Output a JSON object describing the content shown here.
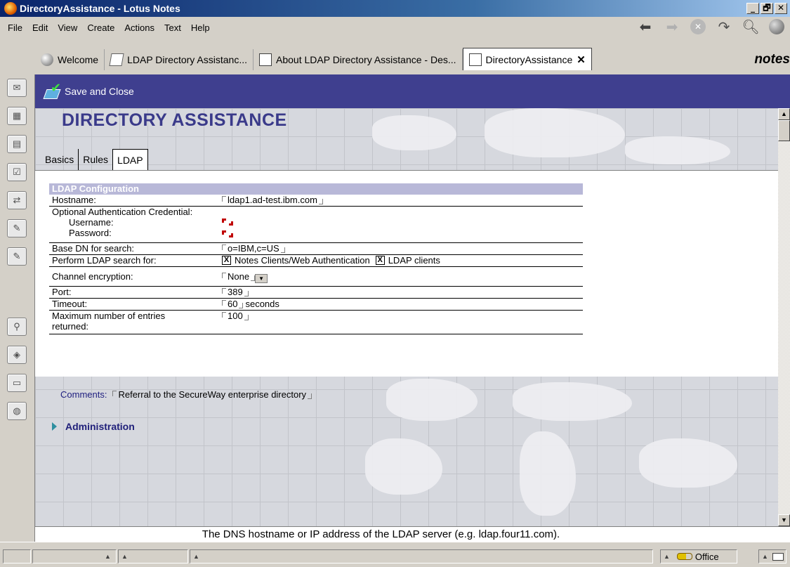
{
  "window": {
    "title": "DirectoryAssistance - Lotus Notes",
    "buttons": {
      "minimize": "_",
      "maximize": "🗗",
      "close": "✕"
    }
  },
  "menu": [
    "File",
    "Edit",
    "View",
    "Create",
    "Actions",
    "Text",
    "Help"
  ],
  "window_tabs": [
    {
      "label": "Welcome",
      "icon": "globe-icon"
    },
    {
      "label": "LDAP Directory Assistanc...",
      "icon": "book-icon"
    },
    {
      "label": "About LDAP Directory Assistance - Des...",
      "icon": "document-icon"
    },
    {
      "label": "DirectoryAssistance",
      "icon": "document-icon",
      "active": true,
      "close": "✕"
    }
  ],
  "brand": "notes",
  "action_bar": {
    "save_close": "Save and Close"
  },
  "document": {
    "title": "DIRECTORY ASSISTANCE",
    "tabs": [
      {
        "label": "Basics"
      },
      {
        "label": "Rules"
      },
      {
        "label": "LDAP",
        "active": true
      }
    ],
    "ldap": {
      "section_title": "LDAP Configuration",
      "hostname_label": "Hostname:",
      "hostname_value": "ldap1.ad-test.ibm.com",
      "auth_label": "Optional Authentication Credential:",
      "username_label": "Username:",
      "password_label": "Password:",
      "basedn_label": "Base DN for search:",
      "basedn_value": "o=IBM,c=US",
      "search_label": "Perform LDAP search for:",
      "search_opt1": "Notes Clients/Web Authentication",
      "search_opt1_checked": true,
      "search_opt2": "LDAP clients",
      "search_opt2_checked": true,
      "check_mark": "X",
      "encryption_label": "Channel encryption:",
      "encryption_value": "None",
      "port_label": "Port:",
      "port_value": "389",
      "timeout_label": "Timeout:",
      "timeout_value": "60",
      "timeout_unit": "seconds",
      "maxentries_label": "Maximum number of entries returned:",
      "maxentries_value": "100"
    },
    "comments_label": "Comments:",
    "comments_value": "Referral to the SecureWay enterprise directory",
    "administration": "Administration"
  },
  "hint": "The DNS hostname or IP address of the LDAP server (e.g. ldap.four11.com).",
  "status": {
    "location": "Office"
  },
  "colors": {
    "title_bar": "#0a246a",
    "action_bar": "#3f3f8f",
    "doc_title": "#3a3a8a",
    "section_header": "#b8b8d8"
  }
}
